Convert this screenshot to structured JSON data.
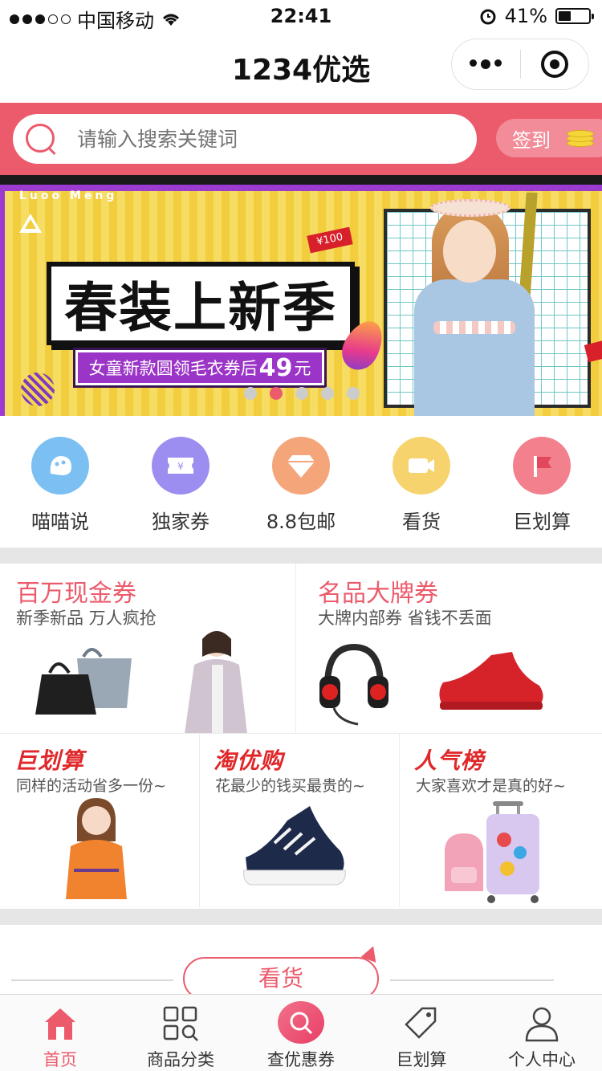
{
  "status_bar": {
    "carrier": "中国移动",
    "time": "22:41",
    "battery": "41%",
    "battery_level": 0.41
  },
  "nav": {
    "title": "1234优选"
  },
  "search": {
    "placeholder": "请输入搜索关键词",
    "signin_label": "签到"
  },
  "banner": {
    "brand": "Luoo Meng",
    "headline": "春装上新季",
    "sub_prefix": "女童新款圆领毛衣券后",
    "sub_price": "49",
    "sub_suffix": "元",
    "tag": "¥100",
    "slide_count": 5,
    "active_slide": 2
  },
  "quick_links": [
    {
      "label": "喵喵说",
      "icon": "cat-icon",
      "color": "#7cc0f3"
    },
    {
      "label": "独家券",
      "icon": "coupon-icon",
      "color": "#9b8ef0"
    },
    {
      "label": "8.8包邮",
      "icon": "diamond-icon",
      "color": "#f4a57a"
    },
    {
      "label": "看货",
      "icon": "video-icon",
      "color": "#f6d36c"
    },
    {
      "label": "巨划算",
      "icon": "flag-icon",
      "color": "#f2808d"
    }
  ],
  "promos_top": [
    {
      "title": "百万现金券",
      "subtitle": "新季新品 万人疯抢"
    },
    {
      "title": "名品大牌券",
      "subtitle": "大牌内部券 省钱不丢面"
    }
  ],
  "promos_bottom": [
    {
      "title": "巨划算",
      "subtitle": "同样的活动省多一份~"
    },
    {
      "title": "淘优购",
      "subtitle": "花最少的钱买最贵的~"
    },
    {
      "title": "人气榜",
      "subtitle": "大家喜欢才是真的好~"
    }
  ],
  "section": {
    "title": "看货"
  },
  "tabs": [
    {
      "label": "首页",
      "icon": "home-icon",
      "active": true
    },
    {
      "label": "商品分类",
      "icon": "category-icon",
      "active": false
    },
    {
      "label": "查优惠券",
      "icon": "search-icon",
      "active": false
    },
    {
      "label": "巨划算",
      "icon": "tag-icon",
      "active": false
    },
    {
      "label": "个人中心",
      "icon": "user-icon",
      "active": false
    }
  ],
  "colors": {
    "accent": "#ec5b6c",
    "promo_red": "#e0272a"
  }
}
